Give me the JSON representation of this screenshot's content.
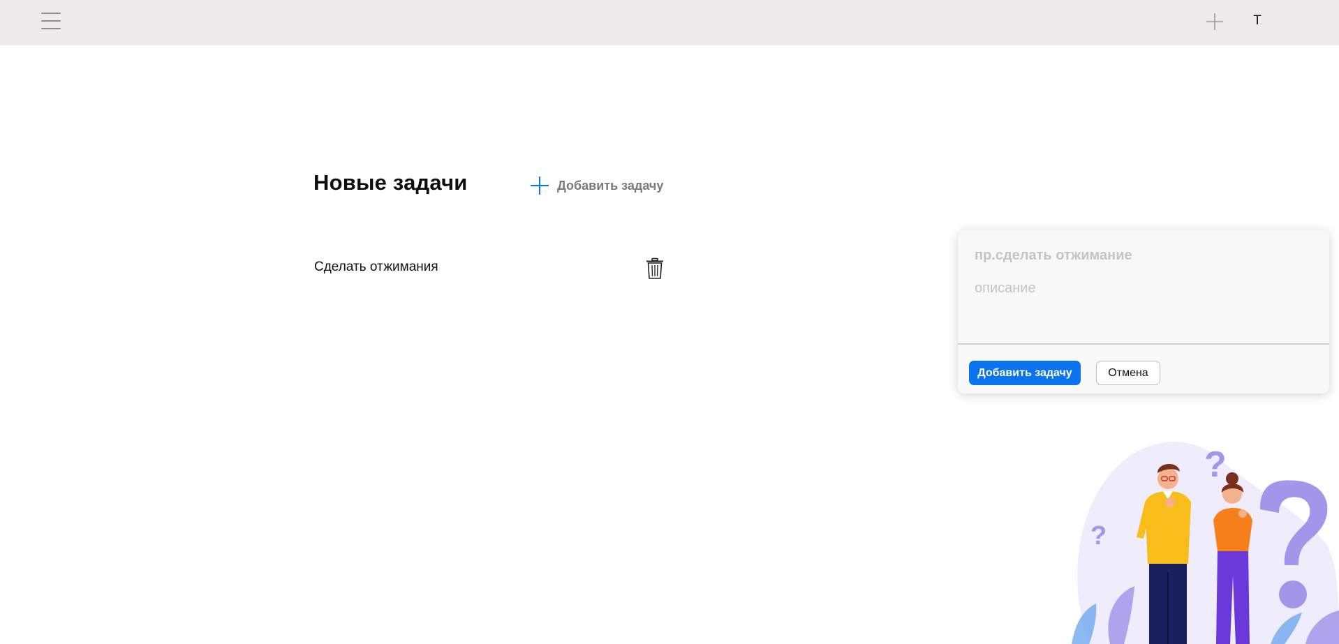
{
  "header": {
    "menu_icon": "hamburger-menu-icon",
    "add_icon": "plus-icon",
    "avatar_initial": "Т"
  },
  "tasks": {
    "section_title": "Новые задачи",
    "add_task_label": "Добавить задачу",
    "add_task_icon": "plus-icon",
    "items": [
      {
        "title": "Сделать отжимания",
        "delete_icon": "trash-icon"
      }
    ]
  },
  "add_form": {
    "title_placeholder": "пр.сделать отжимание",
    "description_placeholder": "описание",
    "submit_label": "Добавить задачу",
    "cancel_label": "Отмена"
  },
  "colors": {
    "accent": "#0a73ee",
    "topbar_bg": "#edebeb",
    "illustration_purple": "#a395ea"
  }
}
